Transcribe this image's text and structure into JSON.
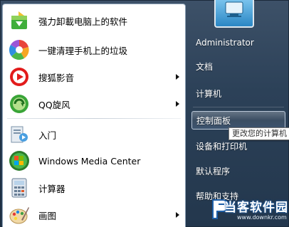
{
  "left_items": [
    {
      "label": "强力卸載电脑上的软件",
      "icon": "uninstall-app-icon",
      "has_arrow": false
    },
    {
      "label": "一键清理手机上的垃圾",
      "icon": "phone-cleaner-icon",
      "has_arrow": false
    },
    {
      "label": "搜狐影音",
      "icon": "sohu-video-icon",
      "has_arrow": true
    },
    {
      "label": "QQ旋风",
      "icon": "qq-whirlwind-icon",
      "has_arrow": true
    },
    {
      "label": "入门",
      "icon": "getting-started-icon",
      "has_arrow": false
    },
    {
      "label": "Windows Media Center",
      "icon": "windows-media-center-icon",
      "has_arrow": false
    },
    {
      "label": "计算器",
      "icon": "calculator-icon",
      "has_arrow": false
    },
    {
      "label": "画图",
      "icon": "paint-icon",
      "has_arrow": true
    }
  ],
  "right_items": [
    {
      "label": "Administrator"
    },
    {
      "label": "文档"
    },
    {
      "label": "计算机"
    },
    {
      "label": "控制面板"
    },
    {
      "label": "设备和打印机"
    },
    {
      "label": "默认程序"
    },
    {
      "label": "帮助和支持"
    }
  ],
  "highlighted_right_item": "控制面板",
  "tooltip": "更改您的计算机",
  "watermark": {
    "title": "当客软件园",
    "url": "www.downkr.com"
  },
  "colors": {
    "menu_background": "#2c4158",
    "highlight_border": "#b9c7d8",
    "watermark_blue": "#1e5fa8"
  }
}
